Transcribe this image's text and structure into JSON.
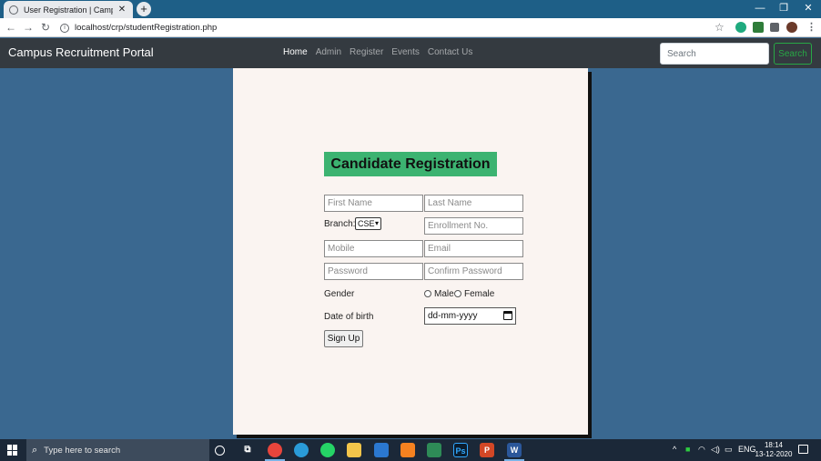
{
  "browser": {
    "tab_title": "User Registration | Campus Recru",
    "url": "localhost/crp/studentRegistration.php",
    "new_tab": "+",
    "close_tab": "✕"
  },
  "navbar": {
    "brand": "Campus Recruitment Portal",
    "links": [
      "Home",
      "Admin",
      "Register",
      "Events",
      "Contact Us"
    ],
    "active_link": "Home",
    "search_placeholder": "Search",
    "search_button": "Search"
  },
  "form": {
    "heading": "Candidate Registration",
    "first_name_placeholder": "First Name",
    "last_name_placeholder": "Last Name",
    "branch_label": "Branch:",
    "branch_value": "CSE",
    "enrollment_placeholder": "Enrollment No.",
    "mobile_placeholder": "Mobile",
    "email_placeholder": "Email",
    "password_placeholder": "Password",
    "confirm_password_placeholder": "Confirm Password",
    "gender_label": "Gender",
    "gender_options": [
      "Male",
      "Female"
    ],
    "dob_label": "Date of birth",
    "dob_placeholder": "dd-mm-yyyy",
    "submit_label": "Sign Up"
  },
  "taskbar": {
    "search_text": "Type here to search",
    "tray_lang": "ENG",
    "time": "18:14",
    "date": "13-12-2020"
  },
  "colors": {
    "page_bg": "#3a6890",
    "navbar_bg": "#343a40",
    "heading_bg": "#3cb371",
    "card_bg": "#faf4f1",
    "search_btn": "#28a745"
  }
}
